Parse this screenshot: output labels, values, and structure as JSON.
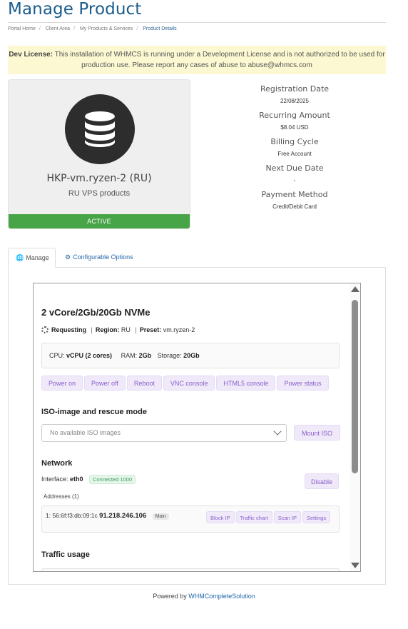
{
  "page": {
    "title": "Manage Product"
  },
  "breadcrumb": [
    {
      "label": "Portal Home"
    },
    {
      "label": "Client Area"
    },
    {
      "label": "My Products & Services"
    },
    {
      "label": "Product Details",
      "active": true
    }
  ],
  "alert": {
    "bold": "Dev License:",
    "text": "This installation of WHMCS is running under a Development License and is not authorized to be used for production use. Please report any cases of abuse to abuse@whmcs.com"
  },
  "product": {
    "name": "HKP-vm.ryzen-2 (RU)",
    "group": "RU VPS products",
    "status": "ACTIVE",
    "icon": "database-icon",
    "status_color": "#47a447"
  },
  "details": {
    "registration_date_label": "Registration Date",
    "registration_date": "22/08/2025",
    "recurring_amount_label": "Recurring Amount",
    "recurring_amount": "$8.04 USD",
    "billing_cycle_label": "Billing Cycle",
    "billing_cycle": "Free Account",
    "next_due_date_label": "Next Due Date",
    "next_due_date": "-",
    "payment_method_label": "Payment Method",
    "payment_method": "Credit/Debit Card"
  },
  "tabs": [
    {
      "label": "Manage",
      "icon": "globe-icon",
      "active": true
    },
    {
      "label": "Configurable Options",
      "icon": "cogs-icon",
      "active": false
    }
  ],
  "vps": {
    "title": "2 vCore/2Gb/20Gb NVMe",
    "status": "Requesting",
    "region_label": "Region:",
    "region": "RU",
    "preset_label": "Preset:",
    "preset": "vm.ryzen-2",
    "cpu_label": "CPU:",
    "cpu": "vCPU (2 cores)",
    "ram_label": "RAM:",
    "ram": "2Gb",
    "storage_label": "Storage:",
    "storage": "20Gb",
    "actions": [
      "Power on",
      "Power off",
      "Reboot",
      "VNC console",
      "HTML5 console",
      "Power status"
    ]
  },
  "iso": {
    "heading": "ISO-image and rescue mode",
    "placeholder": "No available ISO images",
    "mount_label": "Mount ISO"
  },
  "network": {
    "heading": "Network",
    "interface_label": "Interface:",
    "interface": "eth0",
    "connection_badge": "Connected 1000",
    "disable_label": "Disable",
    "addresses_label": "Addresses (1)",
    "address_prefix": "1: 56:6f:f3:db:09:1c",
    "address_ip": "91.218.246.106",
    "address_badge": "Main",
    "address_actions": [
      "Block IP",
      "Traffic chart",
      "Scan IP",
      "Settings"
    ]
  },
  "traffic": {
    "heading": "Traffic usage"
  },
  "footer": {
    "prefix": "Powered by",
    "link": "WHMCompleteSolution"
  },
  "colors": {
    "title": "#1a5c8c",
    "accent_purple": "#8a5fc9",
    "alert_bg": "#fcf8d2",
    "status_green": "#47a447"
  }
}
